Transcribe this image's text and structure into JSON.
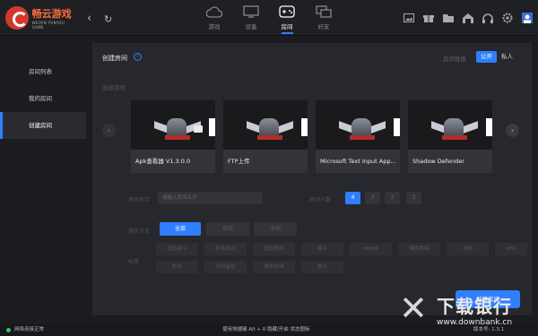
{
  "app": {
    "logo_title": "畅云游戏",
    "logo_sub": "WEIXIN YUNYOU GAME"
  },
  "nav": {
    "back": "‹",
    "refresh": "↻"
  },
  "top_tabs": [
    {
      "label": "游戏",
      "icon": "cloud-icon"
    },
    {
      "label": "设备",
      "icon": "monitor-icon"
    },
    {
      "label": "房间",
      "icon": "gamepad-icon",
      "active": true
    },
    {
      "label": "好友",
      "icon": "friends-icon"
    }
  ],
  "sidebar": {
    "items": [
      {
        "label": "房间列表"
      },
      {
        "label": "我的房间"
      },
      {
        "label": "创建房间",
        "active": true
      }
    ]
  },
  "main": {
    "title": "创建房间",
    "help": "?",
    "privacy_label": "房间性质",
    "privacy_public": "公开",
    "privacy_private": "私人",
    "select_game_label": "选择游戏",
    "prev": "‹",
    "next": "›",
    "games": [
      {
        "name": "Apk查看器 V1.3.0.0"
      },
      {
        "name": "FTP上传"
      },
      {
        "name": "Microsoft Text Input App..."
      },
      {
        "name": "Shadow Defender"
      }
    ],
    "room_name_label": "房间名字",
    "room_name_placeholder": "请输入房间名字",
    "room_size_label": "房间人数",
    "room_sizes": [
      "4",
      "3",
      "2",
      "1"
    ],
    "room_size_selected": "4",
    "mode_label": "操作方式",
    "modes": [
      "全部",
      "键鼠",
      "手柄"
    ],
    "mode_selected": "全部",
    "tag_label": "标签",
    "tags_row1": [
      "近战格斗",
      "射击游戏",
      "冒险竞技",
      "格斗",
      "MOBA",
      "模拟策略",
      "动作",
      "RPG",
      "策略"
    ],
    "tags_row2": [
      "射击",
      "休闲益智",
      "角色扮演",
      "格斗"
    ],
    "create_button": "创建房间"
  },
  "status": {
    "network": "网络连接正常",
    "shortcut": "使用快捷键 Alt + 0 隐藏/开启 状态图标",
    "version": "版本号: 1.3.1"
  },
  "watermark": {
    "title": "下载银行",
    "url": "www.downbank.cn"
  },
  "colors": {
    "accent": "#2f7fff",
    "bg": "#1b1c20",
    "panel": "#27282d"
  }
}
